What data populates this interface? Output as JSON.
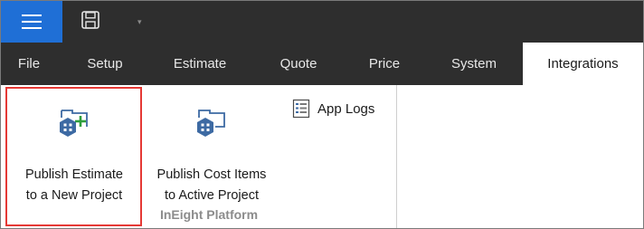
{
  "titlebar": {
    "menu_icon": "hamburger-icon",
    "save_icon": "save-icon",
    "qat_dropdown_icon": "chevron-down-icon"
  },
  "tabs": [
    {
      "label": "File"
    },
    {
      "label": "Setup"
    },
    {
      "label": "Estimate"
    },
    {
      "label": "Quote"
    },
    {
      "label": "Price"
    },
    {
      "label": "System"
    },
    {
      "label": "Integrations",
      "active": true
    }
  ],
  "ribbon": {
    "group_label": "InEight Platform",
    "buttons": {
      "publish_estimate": {
        "line1": "Publish Estimate",
        "line2": "to a New Project",
        "icon": "folder-add-icon"
      },
      "publish_cost_items": {
        "line1": "Publish Cost Items",
        "line2": "to Active Project",
        "icon": "folder-icon"
      },
      "app_logs": {
        "label": "App Logs",
        "icon": "log-document-icon"
      }
    }
  },
  "colors": {
    "titlebar_bg": "#2e2e2e",
    "menu_button_bg": "#1f6fd6",
    "highlight_border": "#e53935",
    "icon_blue": "#3d6aa3",
    "icon_green": "#2e9e3c"
  }
}
